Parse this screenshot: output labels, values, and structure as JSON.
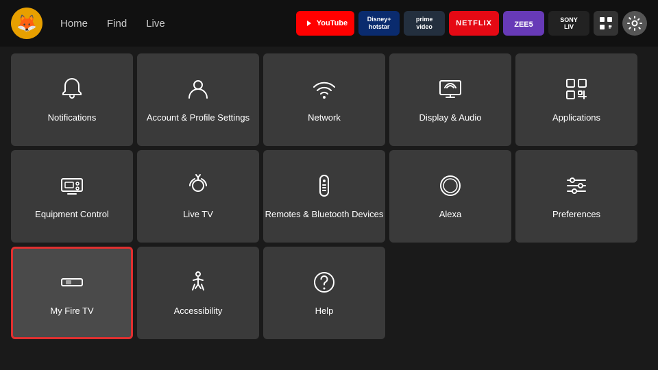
{
  "nav": {
    "logo": "🦊",
    "links": [
      "Home",
      "Find",
      "Live"
    ],
    "apps": [
      {
        "label": "▶ YouTube",
        "class": "app-youtube"
      },
      {
        "label": "Disney+ Hotstar",
        "class": "app-disney"
      },
      {
        "label": "prime video",
        "class": "app-prime"
      },
      {
        "label": "NETFLIX",
        "class": "app-netflix"
      },
      {
        "label": "ZEE5",
        "class": "app-zee5"
      },
      {
        "label": "SONY Liv",
        "class": "app-sony"
      }
    ]
  },
  "grid": {
    "rows": [
      [
        {
          "id": "notifications",
          "label": "Notifications",
          "icon": "bell"
        },
        {
          "id": "account-profile",
          "label": "Account & Profile Settings",
          "icon": "person"
        },
        {
          "id": "network",
          "label": "Network",
          "icon": "wifi"
        },
        {
          "id": "display-audio",
          "label": "Display & Audio",
          "icon": "display"
        },
        {
          "id": "applications",
          "label": "Applications",
          "icon": "apps"
        }
      ],
      [
        {
          "id": "equipment-control",
          "label": "Equipment Control",
          "icon": "tv"
        },
        {
          "id": "live-tv",
          "label": "Live TV",
          "icon": "antenna"
        },
        {
          "id": "remotes-bluetooth",
          "label": "Remotes & Bluetooth Devices",
          "icon": "remote"
        },
        {
          "id": "alexa",
          "label": "Alexa",
          "icon": "alexa"
        },
        {
          "id": "preferences",
          "label": "Preferences",
          "icon": "sliders"
        }
      ],
      [
        {
          "id": "my-fire-tv",
          "label": "My Fire TV",
          "icon": "firetv",
          "selected": true
        },
        {
          "id": "accessibility",
          "label": "Accessibility",
          "icon": "accessibility"
        },
        {
          "id": "help",
          "label": "Help",
          "icon": "help"
        }
      ]
    ]
  }
}
